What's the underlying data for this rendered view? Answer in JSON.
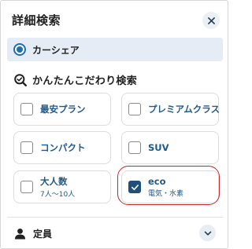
{
  "panel": {
    "title": "詳細検索",
    "close_icon": "close-icon"
  },
  "service": {
    "selected_label": "カーシェア"
  },
  "filters": {
    "heading": "かんたんこだわり検索",
    "options": [
      {
        "label": "最安プラン",
        "sub": "",
        "checked": false
      },
      {
        "label": "プレミアムクラス",
        "sub": "",
        "checked": false
      },
      {
        "label": "コンパクト",
        "sub": "",
        "checked": false
      },
      {
        "label": "SUV",
        "sub": "",
        "checked": false
      },
      {
        "label": "大人数",
        "sub": "7人〜10人",
        "checked": false
      },
      {
        "label": "eco",
        "sub": "電気・水素",
        "checked": true
      }
    ]
  },
  "capacity": {
    "label": "定員",
    "expand_icon": "chevron-down-icon"
  },
  "colors": {
    "accent": "#1f6fae",
    "label_blue": "#1f5a8c",
    "checked_fill": "#1f4f7b",
    "highlight": "#c9262c"
  }
}
